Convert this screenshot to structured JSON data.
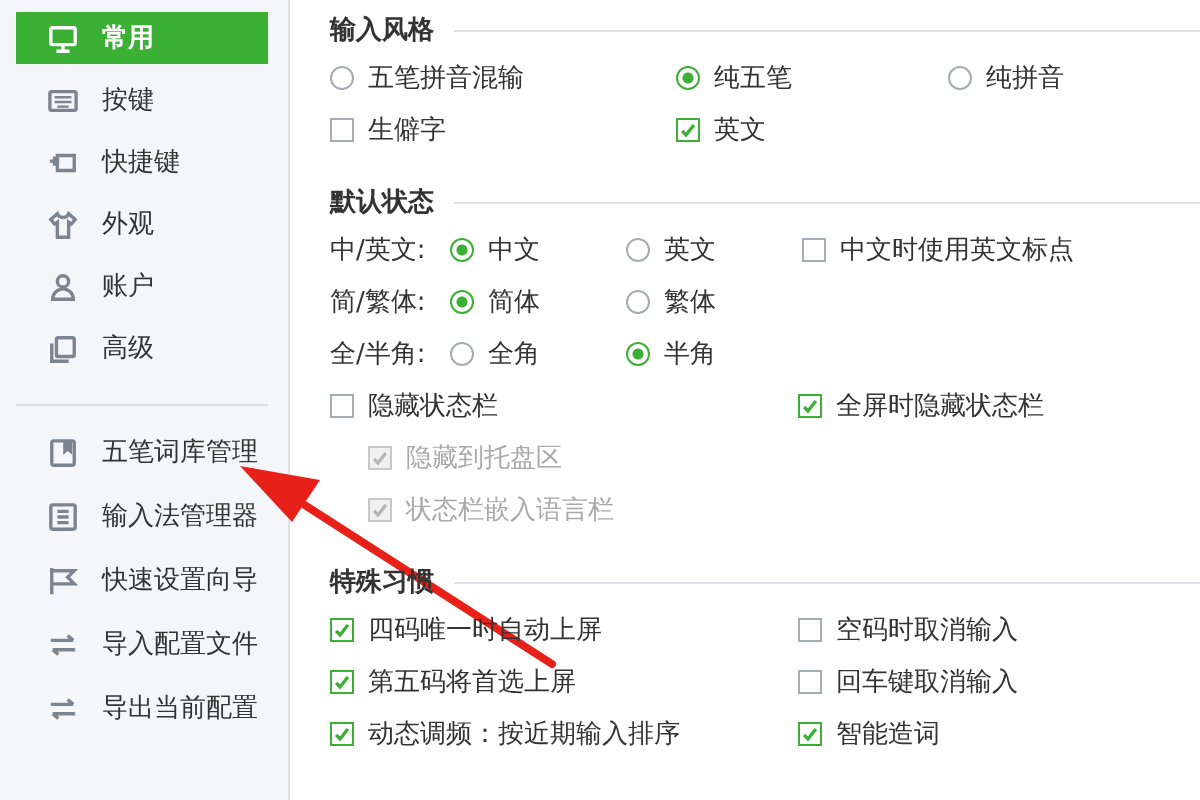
{
  "sidebar": {
    "items": [
      {
        "label": "常用",
        "selected": true
      },
      {
        "label": "按键",
        "selected": false
      },
      {
        "label": "快捷键",
        "selected": false
      },
      {
        "label": "外观",
        "selected": false
      },
      {
        "label": "账户",
        "selected": false
      },
      {
        "label": "高级",
        "selected": false
      }
    ],
    "tools": [
      {
        "label": "五笔词库管理"
      },
      {
        "label": "输入法管理器"
      },
      {
        "label": "快速设置向导"
      },
      {
        "label": "导入配置文件"
      },
      {
        "label": "导出当前配置"
      }
    ]
  },
  "sections": [
    {
      "title": "输入风格",
      "rows": [
        {
          "kind": "triple",
          "controls": [
            {
              "kind": "radio",
              "label": "五笔拼音混输",
              "selected": false
            },
            {
              "kind": "radio",
              "label": "纯五笔",
              "selected": true
            },
            {
              "kind": "radio",
              "label": "纯拼音",
              "selected": false
            }
          ]
        },
        {
          "kind": "triple",
          "controls": [
            {
              "kind": "checkbox",
              "label": "生僻字",
              "checked": false,
              "disabled": false
            },
            {
              "kind": "checkbox",
              "label": "英文",
              "checked": true,
              "disabled": false
            }
          ]
        }
      ]
    },
    {
      "title": "默认状态",
      "rows": [
        {
          "kind": "labeled",
          "label": "中/英文:",
          "controls": [
            {
              "kind": "radio",
              "label": "中文",
              "selected": true
            },
            {
              "kind": "radio",
              "label": "英文",
              "selected": false
            },
            {
              "kind": "checkbox",
              "label": "中文时使用英文标点",
              "checked": false,
              "disabled": false
            }
          ]
        },
        {
          "kind": "labeled",
          "label": "简/繁体:",
          "controls": [
            {
              "kind": "radio",
              "label": "简体",
              "selected": true
            },
            {
              "kind": "radio",
              "label": "繁体",
              "selected": false
            }
          ]
        },
        {
          "kind": "labeled",
          "label": "全/半角:",
          "controls": [
            {
              "kind": "radio",
              "label": "全角",
              "selected": false
            },
            {
              "kind": "radio",
              "label": "半角",
              "selected": true
            }
          ]
        },
        {
          "kind": "pair",
          "controls": [
            {
              "kind": "checkbox",
              "label": "隐藏状态栏",
              "checked": false,
              "disabled": false
            },
            {
              "kind": "checkbox",
              "label": "全屏时隐藏状态栏",
              "checked": true,
              "disabled": false
            }
          ]
        },
        {
          "kind": "sub",
          "controls": [
            {
              "kind": "checkbox",
              "label": "隐藏到托盘区",
              "checked": true,
              "disabled": true
            }
          ]
        },
        {
          "kind": "sub",
          "controls": [
            {
              "kind": "checkbox",
              "label": "状态栏嵌入语言栏",
              "checked": true,
              "disabled": true
            }
          ]
        }
      ]
    },
    {
      "title": "特殊习惯",
      "rows": [
        {
          "kind": "pair",
          "controls": [
            {
              "kind": "checkbox",
              "label": "四码唯一时自动上屏",
              "checked": true,
              "disabled": false
            },
            {
              "kind": "checkbox",
              "label": "空码时取消输入",
              "checked": false,
              "disabled": false
            }
          ]
        },
        {
          "kind": "pair",
          "controls": [
            {
              "kind": "checkbox",
              "label": "第五码将首选上屏",
              "checked": true,
              "disabled": false
            },
            {
              "kind": "checkbox",
              "label": "回车键取消输入",
              "checked": false,
              "disabled": false
            }
          ]
        },
        {
          "kind": "pair",
          "controls": [
            {
              "kind": "checkbox",
              "label": "动态调频：按近期输入排序",
              "checked": true,
              "disabled": false
            },
            {
              "kind": "checkbox",
              "label": "智能造词",
              "checked": true,
              "disabled": false
            }
          ]
        }
      ]
    }
  ]
}
